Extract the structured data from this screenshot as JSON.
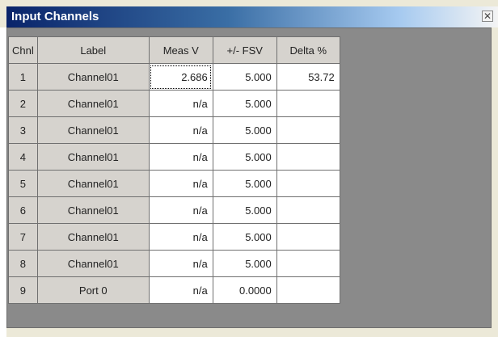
{
  "window": {
    "title": "Input Channels",
    "close_glyph": "✕"
  },
  "table": {
    "columns": [
      "Chnl",
      "Label",
      "Meas V",
      "+/- FSV",
      "Delta %"
    ],
    "rows": [
      {
        "chnl": "1",
        "label": "Channel01",
        "meas": "2.686",
        "fsv": "5.000",
        "delta": "53.72"
      },
      {
        "chnl": "2",
        "label": "Channel01",
        "meas": "n/a",
        "fsv": "5.000",
        "delta": ""
      },
      {
        "chnl": "3",
        "label": "Channel01",
        "meas": "n/a",
        "fsv": "5.000",
        "delta": ""
      },
      {
        "chnl": "4",
        "label": "Channel01",
        "meas": "n/a",
        "fsv": "5.000",
        "delta": ""
      },
      {
        "chnl": "5",
        "label": "Channel01",
        "meas": "n/a",
        "fsv": "5.000",
        "delta": ""
      },
      {
        "chnl": "6",
        "label": "Channel01",
        "meas": "n/a",
        "fsv": "5.000",
        "delta": ""
      },
      {
        "chnl": "7",
        "label": "Channel01",
        "meas": "n/a",
        "fsv": "5.000",
        "delta": ""
      },
      {
        "chnl": "8",
        "label": "Channel01",
        "meas": "n/a",
        "fsv": "5.000",
        "delta": ""
      },
      {
        "chnl": "9",
        "label": "Port 0",
        "meas": "n/a",
        "fsv": "0.0000",
        "delta": ""
      }
    ]
  }
}
